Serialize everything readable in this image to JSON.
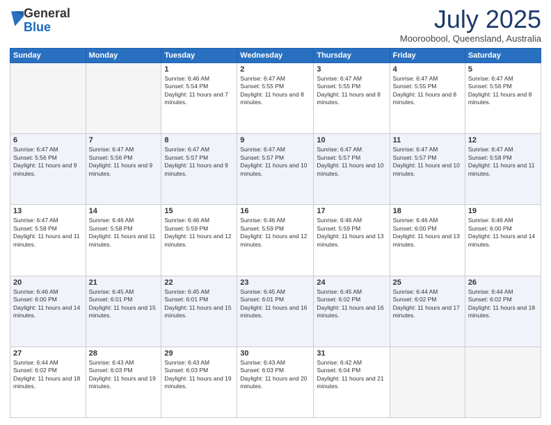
{
  "logo": {
    "general": "General",
    "blue": "Blue"
  },
  "header": {
    "month": "July 2025",
    "location": "Mooroobool, Queensland, Australia"
  },
  "weekdays": [
    "Sunday",
    "Monday",
    "Tuesday",
    "Wednesday",
    "Thursday",
    "Friday",
    "Saturday"
  ],
  "weeks": [
    [
      {
        "day": "",
        "info": ""
      },
      {
        "day": "",
        "info": ""
      },
      {
        "day": "1",
        "info": "Sunrise: 6:46 AM\nSunset: 5:54 PM\nDaylight: 11 hours and 7 minutes."
      },
      {
        "day": "2",
        "info": "Sunrise: 6:47 AM\nSunset: 5:55 PM\nDaylight: 11 hours and 8 minutes."
      },
      {
        "day": "3",
        "info": "Sunrise: 6:47 AM\nSunset: 5:55 PM\nDaylight: 11 hours and 8 minutes."
      },
      {
        "day": "4",
        "info": "Sunrise: 6:47 AM\nSunset: 5:55 PM\nDaylight: 11 hours and 8 minutes."
      },
      {
        "day": "5",
        "info": "Sunrise: 6:47 AM\nSunset: 5:56 PM\nDaylight: 11 hours and 8 minutes."
      }
    ],
    [
      {
        "day": "6",
        "info": "Sunrise: 6:47 AM\nSunset: 5:56 PM\nDaylight: 11 hours and 9 minutes."
      },
      {
        "day": "7",
        "info": "Sunrise: 6:47 AM\nSunset: 5:56 PM\nDaylight: 11 hours and 9 minutes."
      },
      {
        "day": "8",
        "info": "Sunrise: 6:47 AM\nSunset: 5:57 PM\nDaylight: 11 hours and 9 minutes."
      },
      {
        "day": "9",
        "info": "Sunrise: 6:47 AM\nSunset: 5:57 PM\nDaylight: 11 hours and 10 minutes."
      },
      {
        "day": "10",
        "info": "Sunrise: 6:47 AM\nSunset: 5:57 PM\nDaylight: 11 hours and 10 minutes."
      },
      {
        "day": "11",
        "info": "Sunrise: 6:47 AM\nSunset: 5:57 PM\nDaylight: 11 hours and 10 minutes."
      },
      {
        "day": "12",
        "info": "Sunrise: 6:47 AM\nSunset: 5:58 PM\nDaylight: 11 hours and 11 minutes."
      }
    ],
    [
      {
        "day": "13",
        "info": "Sunrise: 6:47 AM\nSunset: 5:58 PM\nDaylight: 11 hours and 11 minutes."
      },
      {
        "day": "14",
        "info": "Sunrise: 6:46 AM\nSunset: 5:58 PM\nDaylight: 11 hours and 11 minutes."
      },
      {
        "day": "15",
        "info": "Sunrise: 6:46 AM\nSunset: 5:59 PM\nDaylight: 11 hours and 12 minutes."
      },
      {
        "day": "16",
        "info": "Sunrise: 6:46 AM\nSunset: 5:59 PM\nDaylight: 11 hours and 12 minutes."
      },
      {
        "day": "17",
        "info": "Sunrise: 6:46 AM\nSunset: 5:59 PM\nDaylight: 11 hours and 13 minutes."
      },
      {
        "day": "18",
        "info": "Sunrise: 6:46 AM\nSunset: 6:00 PM\nDaylight: 11 hours and 13 minutes."
      },
      {
        "day": "19",
        "info": "Sunrise: 6:46 AM\nSunset: 6:00 PM\nDaylight: 11 hours and 14 minutes."
      }
    ],
    [
      {
        "day": "20",
        "info": "Sunrise: 6:46 AM\nSunset: 6:00 PM\nDaylight: 11 hours and 14 minutes."
      },
      {
        "day": "21",
        "info": "Sunrise: 6:45 AM\nSunset: 6:01 PM\nDaylight: 11 hours and 15 minutes."
      },
      {
        "day": "22",
        "info": "Sunrise: 6:45 AM\nSunset: 6:01 PM\nDaylight: 11 hours and 15 minutes."
      },
      {
        "day": "23",
        "info": "Sunrise: 6:45 AM\nSunset: 6:01 PM\nDaylight: 11 hours and 16 minutes."
      },
      {
        "day": "24",
        "info": "Sunrise: 6:45 AM\nSunset: 6:02 PM\nDaylight: 11 hours and 16 minutes."
      },
      {
        "day": "25",
        "info": "Sunrise: 6:44 AM\nSunset: 6:02 PM\nDaylight: 11 hours and 17 minutes."
      },
      {
        "day": "26",
        "info": "Sunrise: 6:44 AM\nSunset: 6:02 PM\nDaylight: 11 hours and 18 minutes."
      }
    ],
    [
      {
        "day": "27",
        "info": "Sunrise: 6:44 AM\nSunset: 6:02 PM\nDaylight: 11 hours and 18 minutes."
      },
      {
        "day": "28",
        "info": "Sunrise: 6:43 AM\nSunset: 6:03 PM\nDaylight: 11 hours and 19 minutes."
      },
      {
        "day": "29",
        "info": "Sunrise: 6:43 AM\nSunset: 6:03 PM\nDaylight: 11 hours and 19 minutes."
      },
      {
        "day": "30",
        "info": "Sunrise: 6:43 AM\nSunset: 6:03 PM\nDaylight: 11 hours and 20 minutes."
      },
      {
        "day": "31",
        "info": "Sunrise: 6:42 AM\nSunset: 6:04 PM\nDaylight: 11 hours and 21 minutes."
      },
      {
        "day": "",
        "info": ""
      },
      {
        "day": "",
        "info": ""
      }
    ]
  ]
}
